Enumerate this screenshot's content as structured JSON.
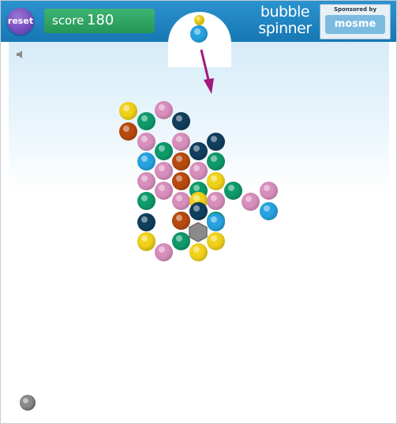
{
  "toolbar": {
    "reset_label": "reset",
    "score_label": "score",
    "score_value": "180"
  },
  "logo": {
    "line1": "bubble",
    "line2": "spinner"
  },
  "sponsor": {
    "label": "Sponsored by",
    "brand": "mosme"
  },
  "colors": {
    "yellow": "#f1d21a",
    "pink": "#d88fbd",
    "green": "#0f9a6a",
    "navy": "#103e5d",
    "orange": "#b84a10",
    "blue": "#26a3e0",
    "gray": "#8a8a8a",
    "arrow": "#a0197c"
  },
  "shooter": {
    "next_bubble": "yellow",
    "loaded_bubble": "blue"
  },
  "board": {
    "bubbles": [
      "yellow",
      "pink",
      "green",
      "navy",
      "orange",
      "pink",
      "green",
      "pink",
      "navy",
      "blue",
      "pink",
      "orange",
      "navy",
      "green",
      "pink",
      "orange",
      "pink",
      "green",
      "yellow",
      "pink",
      "green",
      "pink",
      "yellow",
      "green",
      "pink",
      "pink",
      "yellow",
      "green",
      "navy",
      "green",
      "pink",
      "blue",
      "navy",
      "orange",
      "blue",
      "yellow",
      "yellow",
      "pink",
      "green",
      "yellow",
      "yellow"
    ],
    "center_piece": "gray hexagon"
  },
  "icons": {
    "speaker": "speaker-icon",
    "aim_arrow": "aim-arrow-icon",
    "corner": "round-button-icon"
  }
}
